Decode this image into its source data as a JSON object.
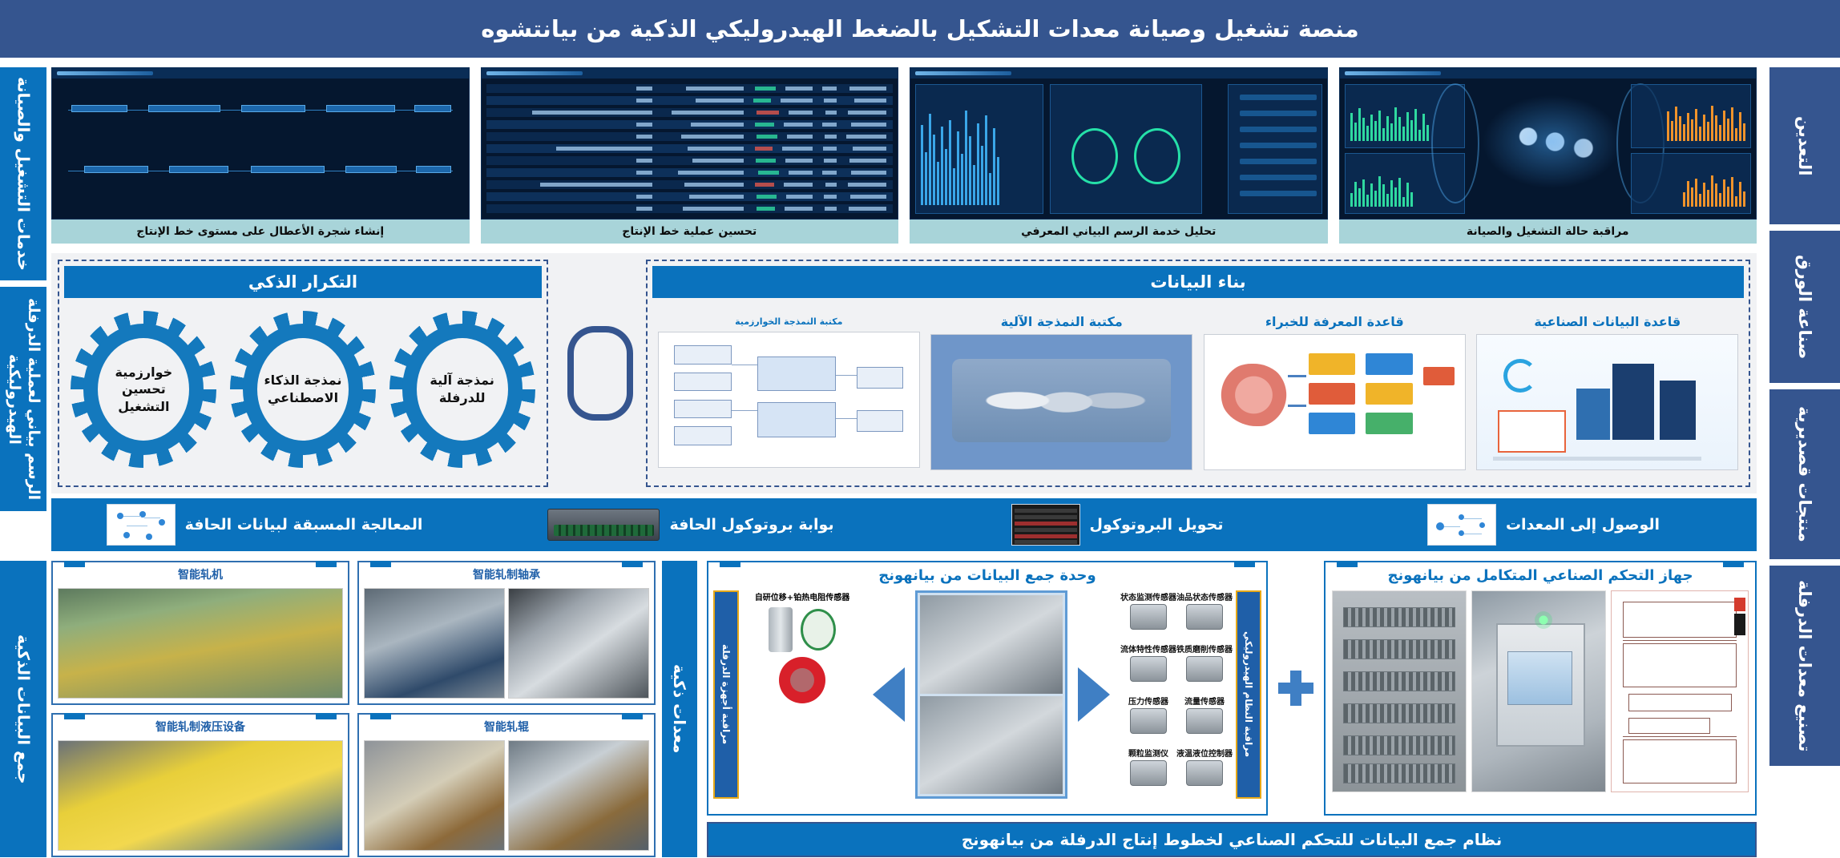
{
  "title": "منصة تشغيل وصيانة معدات التشكيل بالضغط الهيدروليكي الذكية من بيانتشوه",
  "colors": {
    "title_bg": "#35558f",
    "accent_blue": "#0a72bd",
    "caption_bg": "#a8d4d9",
    "panel_bg": "#f1f2f4",
    "gear_blue": "#1479bd",
    "gold": "#e6a817"
  },
  "left_rail": [
    {
      "label": "خدمات التشغيل والصيانة"
    },
    {
      "label": "الرسم بياني لعملية الدرفلة الهيدروليكية"
    },
    {
      "label": "جمع البيانات الذكية"
    }
  ],
  "right_rail": [
    {
      "label": "التعدين"
    },
    {
      "label": "صناعة الورق"
    },
    {
      "label": "منتجات قصديرية"
    },
    {
      "label": "تصنيع معدات الدرفلة"
    }
  ],
  "dashboards": [
    {
      "caption": "مراقبة حالة التشغيل والصيانة"
    },
    {
      "caption": "تحليل خدمة الرسم البياني المعرفي"
    },
    {
      "caption": "تحسين عملية خط الإنتاج"
    },
    {
      "caption": "إنشاء شجرة الأعطال على مستوى خط الإنتاج"
    }
  ],
  "data_construction": {
    "header": "بناء البيانات",
    "cards": [
      {
        "label": "قاعدة البيانات الصناعية"
      },
      {
        "label": "قاعدة المعرفة للخبراء"
      },
      {
        "label": "مكتبة النمذجة الآلية"
      },
      {
        "label": "مكتبة النمذجة الخوارزمية"
      }
    ]
  },
  "smart_iteration": {
    "header": "التكرار الذكي",
    "gears": [
      {
        "label": "نمذجة آلية للدرفلة"
      },
      {
        "label": "نمذجة الذكاء الاصطناعي"
      },
      {
        "label": "خوارزمية تحسين التشغيل"
      }
    ]
  },
  "protocol_bar": [
    {
      "label": "الوصول إلى المعدات",
      "icon": "network-diagram-icon"
    },
    {
      "label": "تحويل البروتوكول",
      "icon": "log-console-icon"
    },
    {
      "label": "بوابة بروتوكول الحافة",
      "icon": "edge-server-icon"
    },
    {
      "label": "المعالجة المسبقة لبيانات الحافة",
      "icon": "node-graph-icon"
    }
  ],
  "bottom": {
    "controller_panel": {
      "title": "جهاز التحكم الصناعي المتكامل من بيانهونج"
    },
    "collector_panel": {
      "title": "وحدة جمع البيانات من بيانهونج",
      "left_vbar": "مراقبة النظام الهيدروليكي",
      "right_vbar": "مراقبة أجهزة الدرفلة",
      "left_sensors": [
        "油品状态传感器",
        "状态监测传感器",
        "铁质磨削传感器",
        "流体特性传感器",
        "流量传感器",
        "压力传感器",
        "液温液位控制器",
        "颗粒监测仪"
      ],
      "right_sensors": [
        "自研位移+铂热电阻传感器"
      ]
    },
    "banner": "نظام جمع البيانات للتحكم الصناعي لخطوط إنتاج الدرفلة من بيانهونج",
    "equipment_rail": "معدات ذكية",
    "equipment_cards": [
      {
        "title": "智能轧制轴承"
      },
      {
        "title": "智能轧机"
      },
      {
        "title": "智能轧辊"
      },
      {
        "title": "智能轧制液压设备"
      }
    ]
  }
}
